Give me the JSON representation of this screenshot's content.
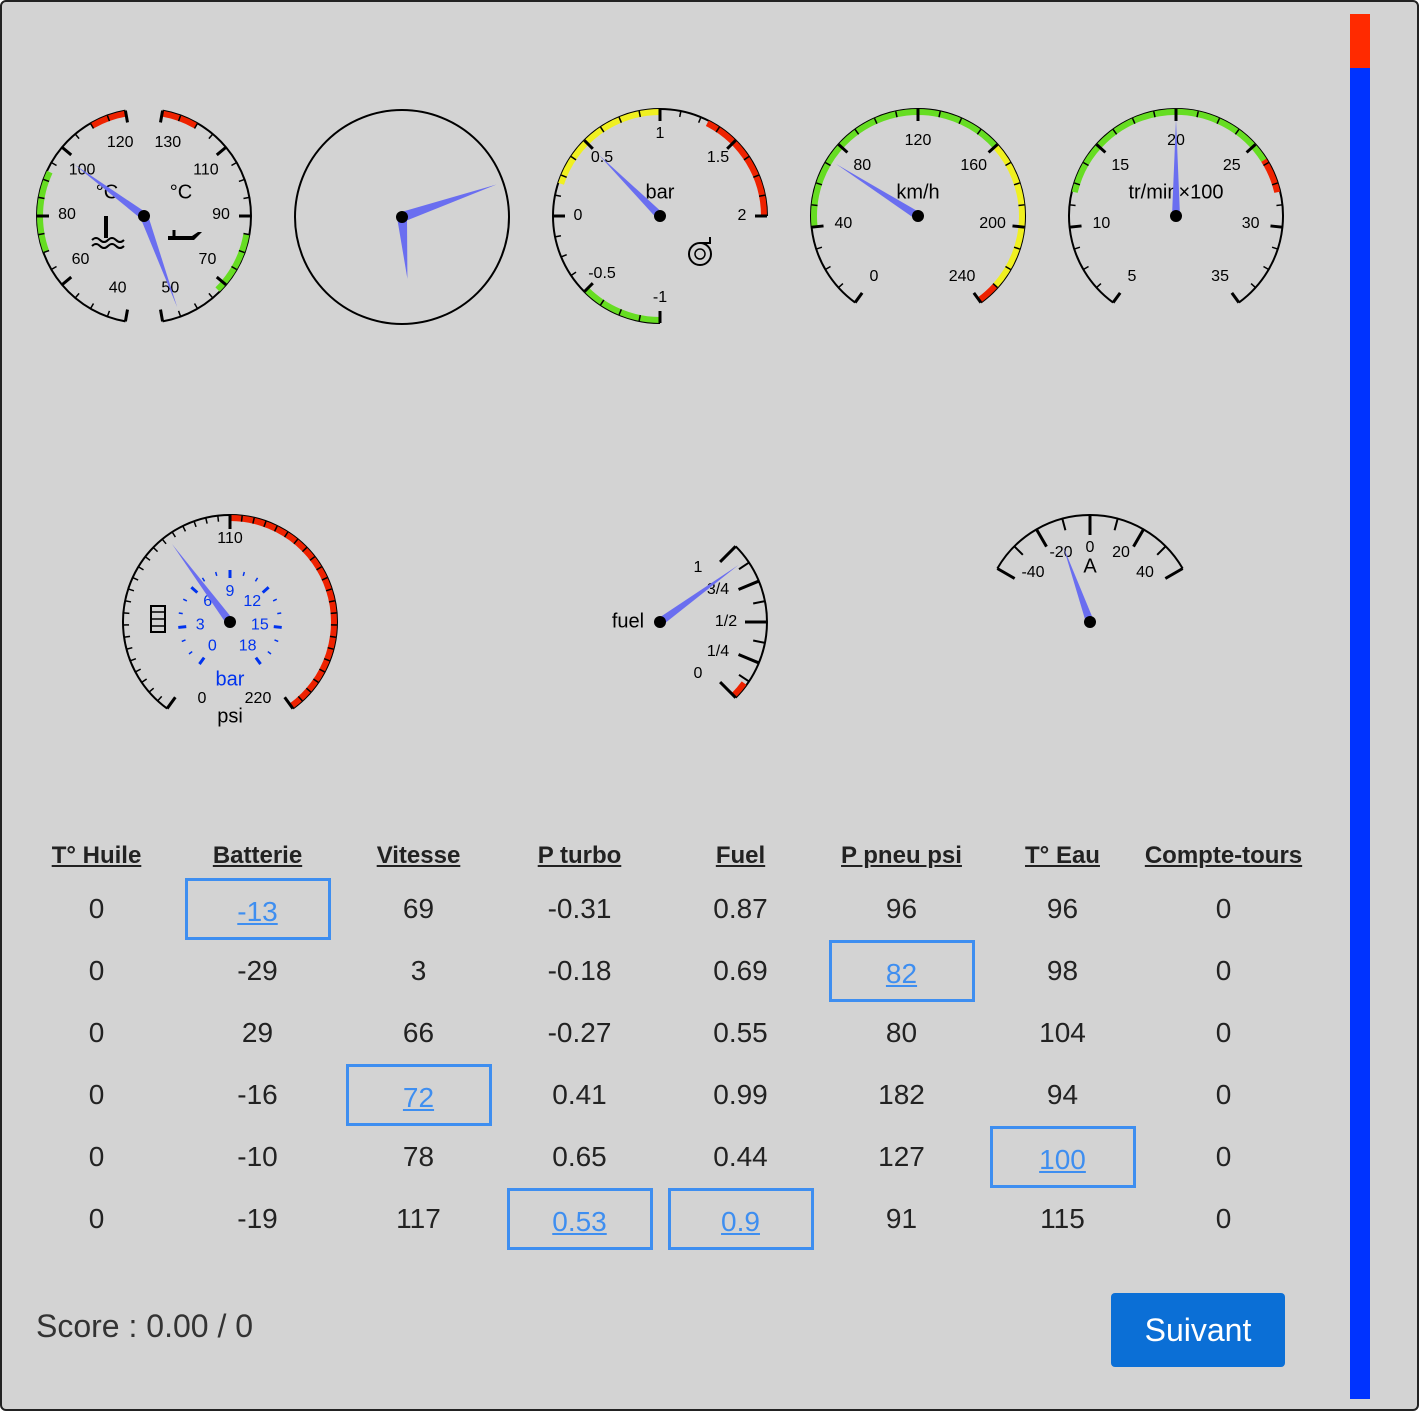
{
  "colors": {
    "needle": "#6a6ef0",
    "green": "#66dd22",
    "yellow": "#f0f020",
    "red": "#ee2200",
    "tire_blue": "#0033ee",
    "button": "#0b6fd6",
    "selected_border": "#3e8ef0"
  },
  "gauges": {
    "temp": {
      "water_unit": "°C",
      "oil_unit": "°C",
      "water_ticks": [
        "40",
        "60",
        "80",
        "100",
        "120"
      ],
      "oil_ticks": [
        "50",
        "70",
        "90",
        "110",
        "130"
      ],
      "water_value": 100,
      "oil_value": 50,
      "water_icon": "thermometer-water-icon",
      "oil_icon": "oil-can-icon"
    },
    "clock": {},
    "turbo": {
      "unit": "bar",
      "ticks": [
        "-1",
        "-0.5",
        "0",
        "0.5",
        "1",
        "1.5",
        "2"
      ],
      "value": 0.5,
      "icon": "turbo-icon"
    },
    "speed": {
      "unit": "km/h",
      "ticks": [
        "0",
        "40",
        "80",
        "120",
        "160",
        "200",
        "240"
      ],
      "value": 72
    },
    "rpm": {
      "unit": "tr/min×100",
      "ticks": [
        "5",
        "10",
        "15",
        "20",
        "25",
        "30",
        "35"
      ],
      "value": 20
    },
    "tire": {
      "outer_unit": "psi",
      "inner_unit": "bar",
      "outer_ticks": [
        "0",
        "110",
        "220"
      ],
      "inner_ticks": [
        "0",
        "3",
        "6",
        "9",
        "12",
        "15",
        "18"
      ],
      "value": 82,
      "icon": "tire-icon"
    },
    "fuel": {
      "label": "fuel",
      "ticks": [
        "0",
        "1/4",
        "1/2",
        "3/4",
        "1"
      ],
      "value": 0.9
    },
    "ammeter": {
      "unit": "A",
      "ticks": [
        "-40",
        "-20",
        "0",
        "20",
        "40"
      ],
      "value": -13
    }
  },
  "timer": {
    "remaining_fraction": 0.961
  },
  "table": {
    "headers": [
      "T° Huile",
      "Batterie",
      "Vitesse",
      "P turbo",
      "Fuel",
      "P pneu psi",
      "T° Eau",
      "Compte-tours"
    ],
    "rows": [
      [
        "0",
        "-13",
        "69",
        "-0.31",
        "0.87",
        "96",
        "96",
        "0"
      ],
      [
        "0",
        "-29",
        "3",
        "-0.18",
        "0.69",
        "82",
        "98",
        "0"
      ],
      [
        "0",
        "29",
        "66",
        "-0.27",
        "0.55",
        "80",
        "104",
        "0"
      ],
      [
        "0",
        "-16",
        "72",
        "0.41",
        "0.99",
        "182",
        "94",
        "0"
      ],
      [
        "0",
        "-10",
        "78",
        "0.65",
        "0.44",
        "127",
        "100",
        "0"
      ],
      [
        "0",
        "-19",
        "117",
        "0.53",
        "0.9",
        "91",
        "115",
        "0"
      ]
    ],
    "selected": [
      [
        0,
        1
      ],
      [
        1,
        5
      ],
      [
        3,
        2
      ],
      [
        4,
        6
      ],
      [
        5,
        3
      ],
      [
        5,
        4
      ]
    ]
  },
  "score": {
    "text": "Score : 0.00 / 0"
  },
  "next_button": {
    "label": "Suivant"
  }
}
